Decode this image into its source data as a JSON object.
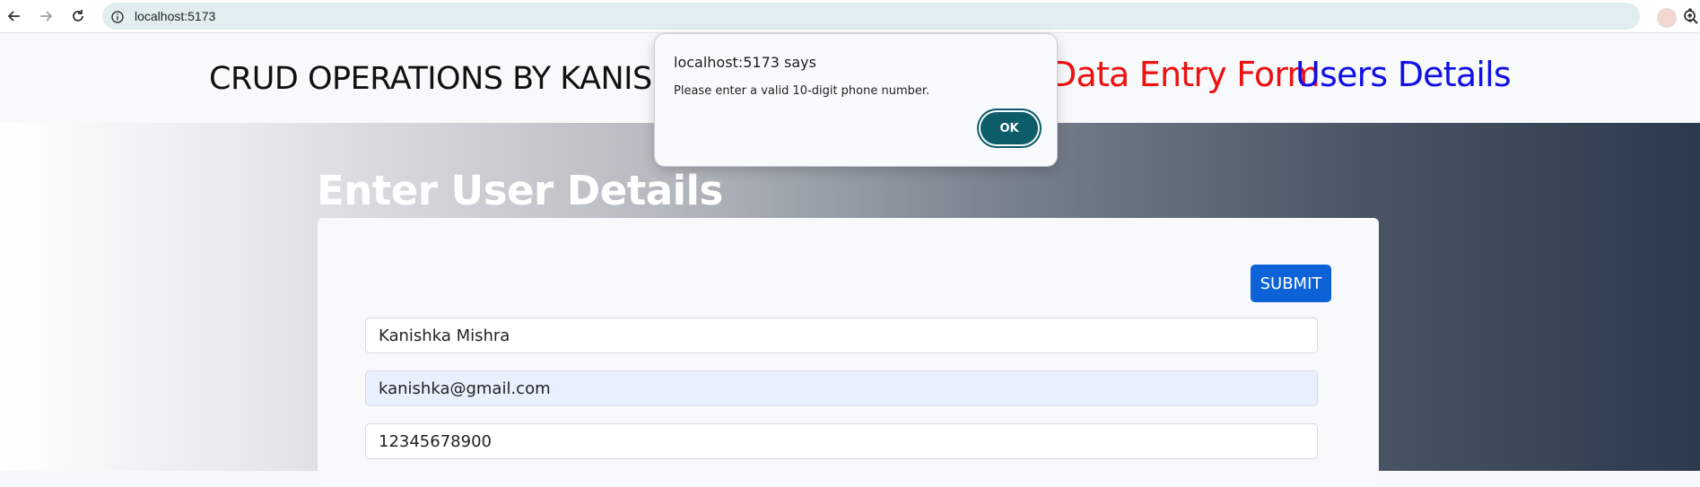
{
  "browser": {
    "url": "localhost:5173",
    "icons": [
      "back-icon",
      "forward-icon",
      "reload-icon",
      "site-info-icon",
      "zoom-icon",
      "star-icon",
      "avatar",
      "menu-icon"
    ]
  },
  "header": {
    "brand": "CRUD OPERATIONS BY KANISHKA",
    "nav": [
      {
        "label": "Data Entry Form",
        "color": "#ee1111"
      },
      {
        "label": "Users Details",
        "color": "#1010e6"
      }
    ]
  },
  "form": {
    "title": "Enter User Details",
    "submit_label": "SUBMIT",
    "fields": [
      {
        "value": "Kanishka Mishra"
      },
      {
        "value": "kanishka@gmail.com"
      },
      {
        "value": "12345678900"
      }
    ]
  },
  "dialog": {
    "title": "localhost:5173 says",
    "message": "Please enter a valid 10-digit phone number.",
    "ok_label": "OK"
  }
}
